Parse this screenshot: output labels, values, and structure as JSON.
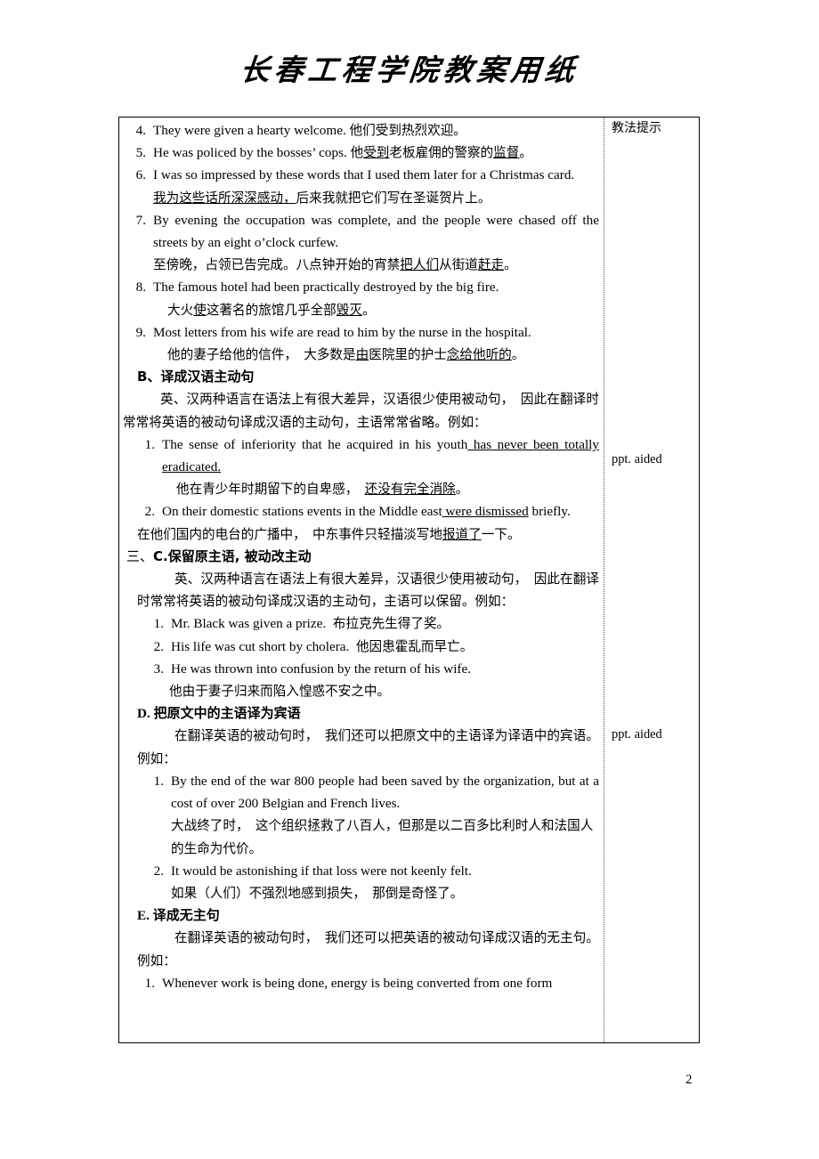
{
  "page": {
    "title": "长春工程学院教案用纸",
    "page_number": "2"
  },
  "side_column": {
    "header": "教法提示",
    "note_1": "ppt. aided",
    "note_2": "ppt. aided"
  },
  "content": {
    "item4": {
      "num": "4.",
      "en": "They were given a hearty welcome.",
      "cn": "他们受到热烈欢迎。"
    },
    "item5": {
      "num": "5.",
      "en": "He was policed by the bosses’ cops.",
      "cn_a": "他",
      "cn_u1": "受到",
      "cn_b": "老板雇佣的警察的",
      "cn_u2": "监督",
      "cn_c": "。"
    },
    "item6": {
      "num": "6.",
      "en": "I was so impressed by these words that I used them later for a Christmas card.",
      "cn_u": "我为这些话所深深感动，",
      "cn_rest": "后来我就把它们写在圣诞贺片上。"
    },
    "item7": {
      "num": "7.",
      "en": "By evening the occupation was complete, and the people were chased off the streets by an eight o’clock curfew.",
      "cn_a": "至傍晚，占领已告完成。八点钟开始的宵禁",
      "cn_u1": "把人们",
      "cn_b": "从街道",
      "cn_u2": "赶走",
      "cn_c": "。"
    },
    "item8": {
      "num": "8.",
      "en": "The famous hotel had been practically destroyed by the big fire.",
      "cn_a": "大火",
      "cn_u1": "使",
      "cn_b": "这著名的旅馆几乎全部",
      "cn_u2": "毁灭",
      "cn_c": "。"
    },
    "item9": {
      "num": "9.",
      "en": "Most letters from his wife are read to him by the nurse in the hospital.",
      "cn_a": "他的妻子给他的信件，　大多数是",
      "cn_u1": "由",
      "cn_b": "医院里的护士",
      "cn_u2": "念给他听的",
      "cn_c": "。"
    },
    "sectionB": {
      "heading": "B、译成汉语主动句",
      "para": "英、汉两种语言在语法上有很大差异，汉语很少使用被动句，　因此在翻译时常常将英语的被动句译成汉语的主动句，主语常常省略。例如：",
      "b1": {
        "num": "1.",
        "en_a": "The sense of inferiority that he acquired in his youth",
        "en_u": " has never been totally eradicated.",
        "cn_a": "他在青少年时期留下的自卑感，　",
        "cn_u": "还没有完全消除",
        "cn_b": "。"
      },
      "b2": {
        "num": "2.",
        "en_a": "On their domestic stations events in the Middle east",
        "en_u": " were dismissed",
        "en_b": " briefly.",
        "cn_a": "在他们国内的电台的广播中，　中东事件只轻描淡写地",
        "cn_u": "报道了",
        "cn_b": "一下。"
      }
    },
    "sectionC": {
      "heading_cn": "三、",
      "heading_rest": "C.保留原主语, 被动改主动",
      "para": "英、汉两种语言在语法上有很大差异，汉语很少使用被动句，　因此在翻译时常常将英语的被动句译成汉语的主动句，主语可以保留。例如：",
      "c1": {
        "num": "1.",
        "en": "Mr. Black was given a prize.",
        "cn": "布拉克先生得了奖。"
      },
      "c2": {
        "num": "2.",
        "en": "His life was cut short by cholera.",
        "cn": "他因患霍乱而早亡。"
      },
      "c3": {
        "num": "3.",
        "en": "He was thrown into confusion by the return of his wife.",
        "cn": "他由于妻子归来而陷入惶惑不安之中。"
      }
    },
    "sectionD": {
      "heading_letter": "D.",
      "heading_cn": "把原文中的主语译为宾语",
      "para": "在翻译英语的被动句时，　我们还可以把原文中的主语译为译语中的宾语。例如：",
      "d1": {
        "num": "1.",
        "en": "By the end of the war 800 people had been saved by the organization, but at a cost of over 200 Belgian and French lives.",
        "cn": "大战终了时，　这个组织拯救了八百人，但那是以二百多比利时人和法国人的生命为代价。"
      },
      "d2": {
        "num": "2.",
        "en": "It would be astonishing if that loss were not keenly felt.",
        "cn": "如果（人们）不强烈地感到损失，　那倒是奇怪了。"
      }
    },
    "sectionE": {
      "heading_letter": "E.",
      "heading_cn": "译成无主句",
      "para": "在翻译英语的被动句时，　我们还可以把英语的被动句译成汉语的无主句。例如：",
      "e1": {
        "num": "1.",
        "en": "Whenever work is being done, energy is being converted from one form"
      }
    }
  }
}
